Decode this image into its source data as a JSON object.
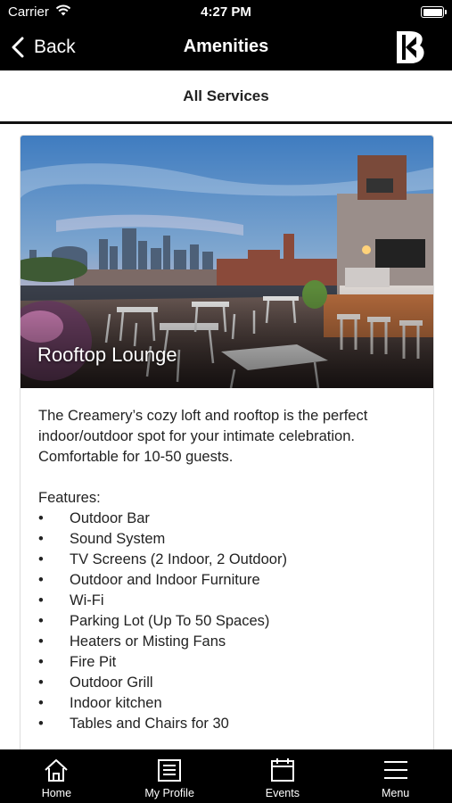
{
  "status_bar": {
    "carrier": "Carrier",
    "time": "4:27 PM",
    "battery_level": 1.0
  },
  "nav": {
    "back_label": "Back",
    "title": "Amenities"
  },
  "sub_header": {
    "label": "All Services"
  },
  "card": {
    "title": "Rooftop Lounge",
    "description": "The Creamery’s cozy loft and rooftop is the perfect indoor/outdoor spot for your intimate celebration. Comfortable for 10-50 guests.",
    "features_heading": "Features:",
    "bullet": "•",
    "features": [
      "Outdoor Bar",
      "Sound System",
      "TV Screens (2 Indoor, 2 Outdoor)",
      "Outdoor and Indoor Furniture",
      "Wi-Fi",
      "Parking Lot (Up To 50 Spaces)",
      "Heaters or Misting Fans",
      "Fire Pit",
      "Outdoor Grill",
      "Indoor kitchen",
      "Tables and Chairs for 30"
    ]
  },
  "tabs": [
    {
      "label": "Home",
      "icon": "home-icon"
    },
    {
      "label": "My Profile",
      "icon": "profile-icon"
    },
    {
      "label": "Events",
      "icon": "calendar-icon"
    },
    {
      "label": "Menu",
      "icon": "menu-icon"
    }
  ],
  "colors": {
    "bar_background": "#000000",
    "bar_text": "#ffffff",
    "body_text": "#222222"
  }
}
